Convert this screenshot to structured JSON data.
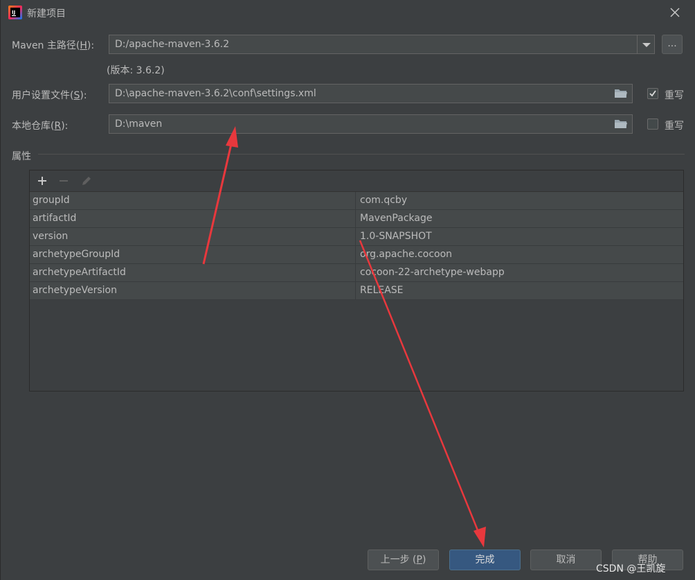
{
  "window": {
    "title": "新建项目",
    "close_icon": "close-icon",
    "app_icon": "intellij-icon"
  },
  "maven_home": {
    "label": "Maven 主路径(",
    "mnemonic": "H",
    "label_end": "):",
    "value": "D:/apache-maven-3.6.2",
    "browse_label": "...",
    "version_text": "(版本: 3.6.2)"
  },
  "user_settings": {
    "label": "用户设置文件(",
    "mnemonic": "S",
    "label_end": "):",
    "value": "D:\\apache-maven-3.6.2\\conf\\settings.xml",
    "override_label": "重写",
    "override_checked": true
  },
  "local_repo": {
    "label": "本地仓库(",
    "mnemonic": "R",
    "label_end": "):",
    "value": "D:\\maven",
    "override_label": "重写",
    "override_checked": false
  },
  "properties": {
    "section_label": "属性",
    "rows": [
      {
        "key": "groupId",
        "value": "com.qcby"
      },
      {
        "key": "artifactId",
        "value": "MavenPackage"
      },
      {
        "key": "version",
        "value": "1.0-SNAPSHOT"
      },
      {
        "key": "archetypeGroupId",
        "value": "org.apache.cocoon"
      },
      {
        "key": "archetypeArtifactId",
        "value": "cocoon-22-archetype-webapp"
      },
      {
        "key": "archetypeVersion",
        "value": "RELEASE"
      }
    ]
  },
  "buttons": {
    "previous_label": "上一步 (",
    "previous_mnemonic": "P",
    "previous_end": ")",
    "finish_label": "完成",
    "cancel_label": "取消",
    "help_label": "帮助"
  },
  "watermark": "CSDN @王凯旋",
  "colors": {
    "background": "#3c3f41",
    "field_bg": "#45494a",
    "primary_button": "#365880",
    "annotation_arrow": "#e8383d"
  }
}
